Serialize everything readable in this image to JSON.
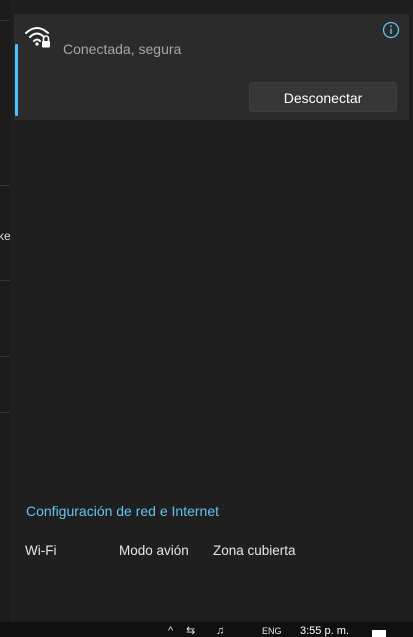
{
  "network": {
    "status": "Conectada, segura",
    "disconnect_label": "Desconectar",
    "wifi_icon": "wifi-secured-icon",
    "info_icon": "info-icon"
  },
  "background_window": {
    "partial_text": "ke"
  },
  "footer": {
    "settings_link": "Configuración de red e Internet",
    "quick_actions": [
      {
        "label": "Wi-Fi"
      },
      {
        "label": "Modo avión"
      },
      {
        "label": "Zona cubierta"
      }
    ]
  },
  "taskbar": {
    "language": "ENG",
    "time": "3:55 p. m."
  },
  "colors": {
    "accent": "#4cc2ff",
    "link": "#63c3ee",
    "panel": "#1f1f1f",
    "card": "#2b2b2b"
  }
}
